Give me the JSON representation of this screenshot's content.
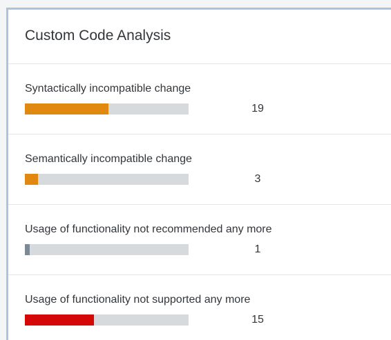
{
  "card": {
    "title": "Custom Code Analysis"
  },
  "items": [
    {
      "label": "Syntactically incompatible change",
      "count": "19",
      "fill_fraction": 0.51,
      "color": "#e0880f"
    },
    {
      "label": "Semantically incompatible change",
      "count": "3",
      "fill_fraction": 0.08,
      "color": "#e0880f"
    },
    {
      "label": "Usage of functionality not recommended any more",
      "count": "1",
      "fill_fraction": 0.03,
      "color": "#7d8a96"
    },
    {
      "label": "Usage of functionality not supported any more",
      "count": "15",
      "fill_fraction": 0.42,
      "color": "#d50808"
    }
  ]
}
